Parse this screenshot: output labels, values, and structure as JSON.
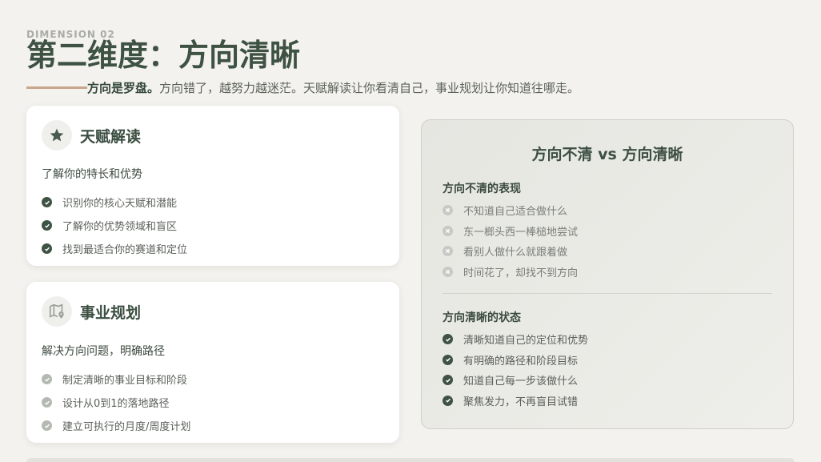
{
  "header": {
    "eyebrow": "DIMENSION 02",
    "title": "第二维度：方向清晰",
    "subtitle_bold": "方向是罗盘。",
    "subtitle_rest": "方向错了，越努力越迷茫。天赋解读让你看清自己，事业规划让你知道往哪走。"
  },
  "cards": [
    {
      "icon": "star-icon",
      "title": "天赋解读",
      "lead": "了解你的特长和优势",
      "items": [
        "识别你的核心天赋和潜能",
        "了解你的优势领域和盲区",
        "找到最适合你的赛道和定位"
      ]
    },
    {
      "icon": "map-pin-icon",
      "title": "事业规划",
      "lead": "解决方向问题，明确路径",
      "items": [
        "制定清晰的事业目标和阶段",
        "设计从0到1的落地路径",
        "建立可执行的月度/周度计划"
      ]
    }
  ],
  "compare": {
    "title": "方向不清 vs 方向清晰",
    "bad_title": "方向不清的表现",
    "bad_items": [
      "不知道自己适合做什么",
      "东一榔头西一棒槌地尝试",
      "看别人做什么就跟着做",
      "时间花了，却找不到方向"
    ],
    "good_title": "方向清晰的状态",
    "good_items": [
      "清晰知道自己的定位和优势",
      "有明确的路径和阶段目标",
      "知道自己每一步该做什么",
      "聚焦发力，不再盲目试错"
    ]
  },
  "colors": {
    "accent": "#3d5243",
    "line": "#c9a68a",
    "background": "#f4f2ee"
  }
}
